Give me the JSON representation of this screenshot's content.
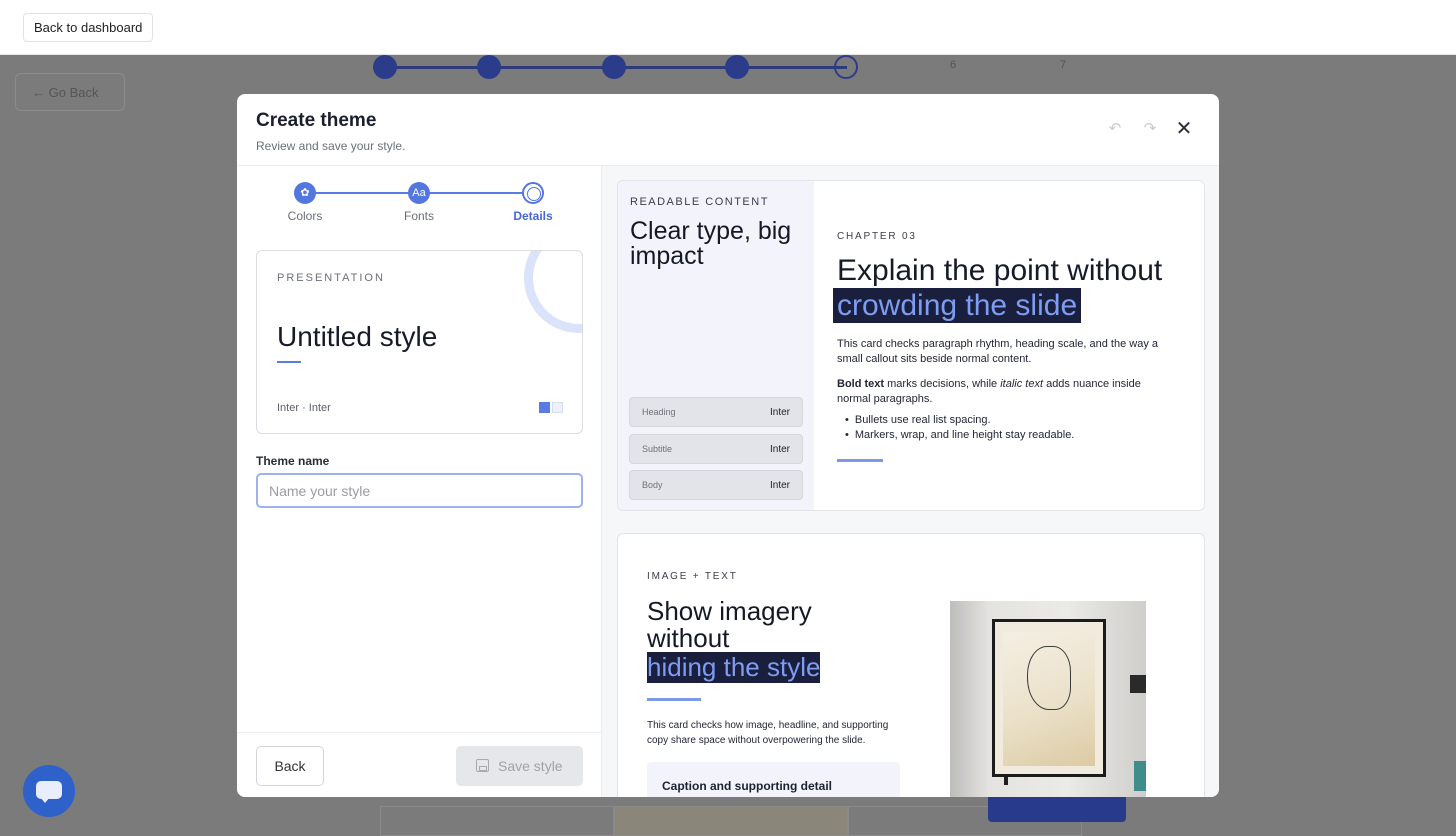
{
  "topbar": {
    "back_label": "Back to dashboard"
  },
  "background": {
    "go_back_label": "Go Back",
    "step_numbers": [
      "6",
      "7"
    ]
  },
  "modal": {
    "title": "Create theme",
    "subtitle": "Review and save your style.",
    "icons": {
      "undo": "undo-icon",
      "redo": "redo-icon",
      "close": "close-icon"
    }
  },
  "stepper": {
    "steps": [
      {
        "label": "Colors",
        "icon": "palette-icon",
        "state": "done"
      },
      {
        "label": "Fonts",
        "icon": "font-icon",
        "state": "done"
      },
      {
        "label": "Details",
        "icon": "info-icon",
        "state": "current"
      }
    ],
    "accent": "#5377df"
  },
  "preview_card": {
    "eyebrow": "PRESENTATION",
    "title": "Untitled style",
    "fonts": "Inter · Inter",
    "swatches": [
      "#5b7be3",
      "#eef1fb"
    ]
  },
  "form": {
    "label": "Theme name",
    "value": "",
    "placeholder": "Name your style"
  },
  "footer": {
    "back_label": "Back",
    "save_label": "Save style"
  },
  "readable_card": {
    "eyebrow": "READABLE CONTENT",
    "title": "Clear type, big impact",
    "rows": [
      {
        "key": "Heading",
        "value": "Inter"
      },
      {
        "key": "Subtitle",
        "value": "Inter"
      },
      {
        "key": "Body",
        "value": "Inter"
      }
    ],
    "chapter": "CHAPTER 03",
    "heading_plain": "Explain the point without",
    "heading_highlight": "crowding the slide",
    "para1": "This card checks paragraph rhythm, heading scale, and the way a small callout sits beside normal content.",
    "para2_bold": "Bold text",
    "para2_mid": " marks decisions, while ",
    "para2_italic": "italic text",
    "para2_end": " adds nuance inside normal paragraphs.",
    "bullets": [
      "Bullets use real list spacing.",
      "Markers, wrap, and line height stay readable."
    ]
  },
  "image_card": {
    "eyebrow": "IMAGE + TEXT",
    "title_plain": "Show imagery without",
    "title_highlight": "hiding the style",
    "para": "This card checks how image, headline, and supporting copy share space without overpowering the slide.",
    "caption": "Caption and supporting detail"
  },
  "chat": {
    "icon": "chat-icon"
  }
}
